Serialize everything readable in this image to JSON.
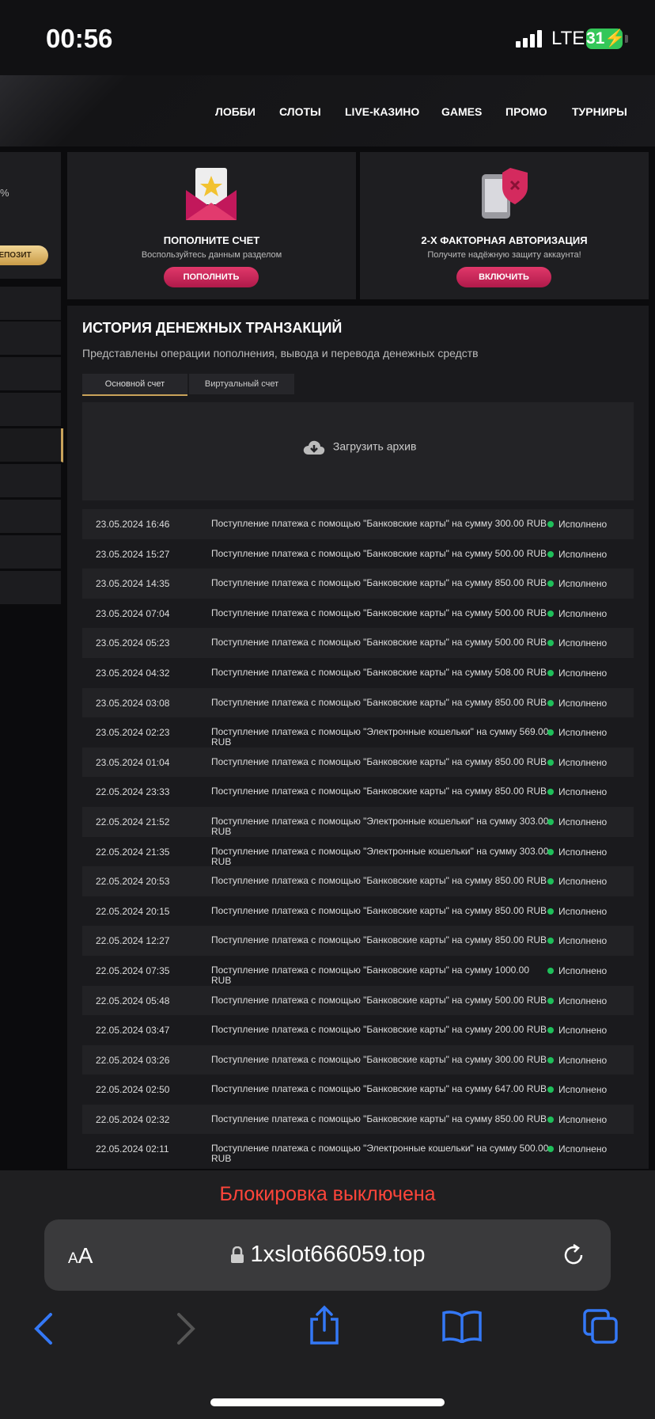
{
  "status_bar": {
    "time": "00:56",
    "network": "LTE",
    "battery": "31"
  },
  "nav": {
    "items": [
      "ЛОББИ",
      "СЛОТЫ",
      "LIVE-КАЗИНО",
      "GAMES",
      "ПРОМО",
      "ТУРНИРЫ"
    ]
  },
  "left_panel": {
    "percent": "%",
    "deposit_label": "ДЕПОЗИТ"
  },
  "cards": {
    "deposit": {
      "title": "ПОПОЛНИТЕ СЧЕТ",
      "subtitle": "Воспользуйтесь данным разделом",
      "button": "ПОПОЛНИТЬ"
    },
    "twofa": {
      "title": "2-Х ФАКТОРНАЯ АВТОРИЗАЦИЯ",
      "subtitle": "Получите надёжную защиту аккаунта!",
      "button": "ВКЛЮЧИТЬ"
    }
  },
  "history": {
    "title": "ИСТОРИЯ ДЕНЕЖНЫХ ТРАНЗАКЦИЙ",
    "subtitle": "Представлены операции пополнения, вывода и перевода денежных средств",
    "tabs": [
      "Основной счет",
      "Виртуальный счет"
    ],
    "archive_label": "Загрузить архив",
    "transactions": [
      {
        "date": "23.05.2024 16:46",
        "description": "Поступление платежа с помощью \"Банковские карты\" на сумму 300.00 RUB",
        "status": "Исполнено"
      },
      {
        "date": "23.05.2024 15:27",
        "description": "Поступление платежа с помощью \"Банковские карты\" на сумму 500.00 RUB",
        "status": "Исполнено"
      },
      {
        "date": "23.05.2024 14:35",
        "description": "Поступление платежа с помощью \"Банковские карты\" на сумму 850.00 RUB",
        "status": "Исполнено"
      },
      {
        "date": "23.05.2024 07:04",
        "description": "Поступление платежа с помощью \"Банковские карты\" на сумму 500.00 RUB",
        "status": "Исполнено"
      },
      {
        "date": "23.05.2024 05:23",
        "description": "Поступление платежа с помощью \"Банковские карты\" на сумму 500.00 RUB",
        "status": "Исполнено"
      },
      {
        "date": "23.05.2024 04:32",
        "description": "Поступление платежа с помощью \"Банковские карты\" на сумму 508.00 RUB",
        "status": "Исполнено"
      },
      {
        "date": "23.05.2024 03:08",
        "description": "Поступление платежа с помощью \"Банковские карты\" на сумму 850.00 RUB",
        "status": "Исполнено"
      },
      {
        "date": "23.05.2024 02:23",
        "description": "Поступление платежа с помощью \"Электронные кошельки\" на сумму 569.00 RUB",
        "status": "Исполнено"
      },
      {
        "date": "23.05.2024 01:04",
        "description": "Поступление платежа с помощью \"Банковские карты\" на сумму 850.00 RUB",
        "status": "Исполнено"
      },
      {
        "date": "22.05.2024 23:33",
        "description": "Поступление платежа с помощью \"Банковские карты\" на сумму 850.00 RUB",
        "status": "Исполнено"
      },
      {
        "date": "22.05.2024 21:52",
        "description": "Поступление платежа с помощью \"Электронные кошельки\" на сумму 303.00 RUB",
        "status": "Исполнено"
      },
      {
        "date": "22.05.2024 21:35",
        "description": "Поступление платежа с помощью \"Электронные кошельки\" на сумму 303.00 RUB",
        "status": "Исполнено"
      },
      {
        "date": "22.05.2024 20:53",
        "description": "Поступление платежа с помощью \"Банковские карты\" на сумму 850.00 RUB",
        "status": "Исполнено"
      },
      {
        "date": "22.05.2024 20:15",
        "description": "Поступление платежа с помощью \"Банковские карты\" на сумму 850.00 RUB",
        "status": "Исполнено"
      },
      {
        "date": "22.05.2024 12:27",
        "description": "Поступление платежа с помощью \"Банковские карты\" на сумму 850.00 RUB",
        "status": "Исполнено"
      },
      {
        "date": "22.05.2024 07:35",
        "description": "Поступление платежа с помощью \"Банковские карты\" на сумму 1000.00 RUB",
        "status": "Исполнено"
      },
      {
        "date": "22.05.2024 05:48",
        "description": "Поступление платежа с помощью \"Банковские карты\" на сумму 500.00 RUB",
        "status": "Исполнено"
      },
      {
        "date": "22.05.2024 03:47",
        "description": "Поступление платежа с помощью \"Банковские карты\" на сумму 200.00 RUB",
        "status": "Исполнено"
      },
      {
        "date": "22.05.2024 03:26",
        "description": "Поступление платежа с помощью \"Банковские карты\" на сумму 300.00 RUB",
        "status": "Исполнено"
      },
      {
        "date": "22.05.2024 02:50",
        "description": "Поступление платежа с помощью \"Банковские карты\" на сумму 647.00 RUB",
        "status": "Исполнено"
      },
      {
        "date": "22.05.2024 02:32",
        "description": "Поступление платежа с помощью \"Банковские карты\" на сумму 850.00 RUB",
        "status": "Исполнено"
      },
      {
        "date": "22.05.2024 02:11",
        "description": "Поступление платежа с помощью \"Электронные кошельки\" на сумму 500.00 RUB",
        "status": "Исполнено"
      }
    ]
  },
  "browser": {
    "lock_status": "Блокировка выключена",
    "aa_label": "AA",
    "url": "1xslot666059.top"
  },
  "colors": {
    "accent_gold": "#c9a35a",
    "accent_pink": "#d42a5e",
    "status_green": "#1fbf5a",
    "ios_red": "#ff453a",
    "ios_blue": "#3478f6"
  }
}
